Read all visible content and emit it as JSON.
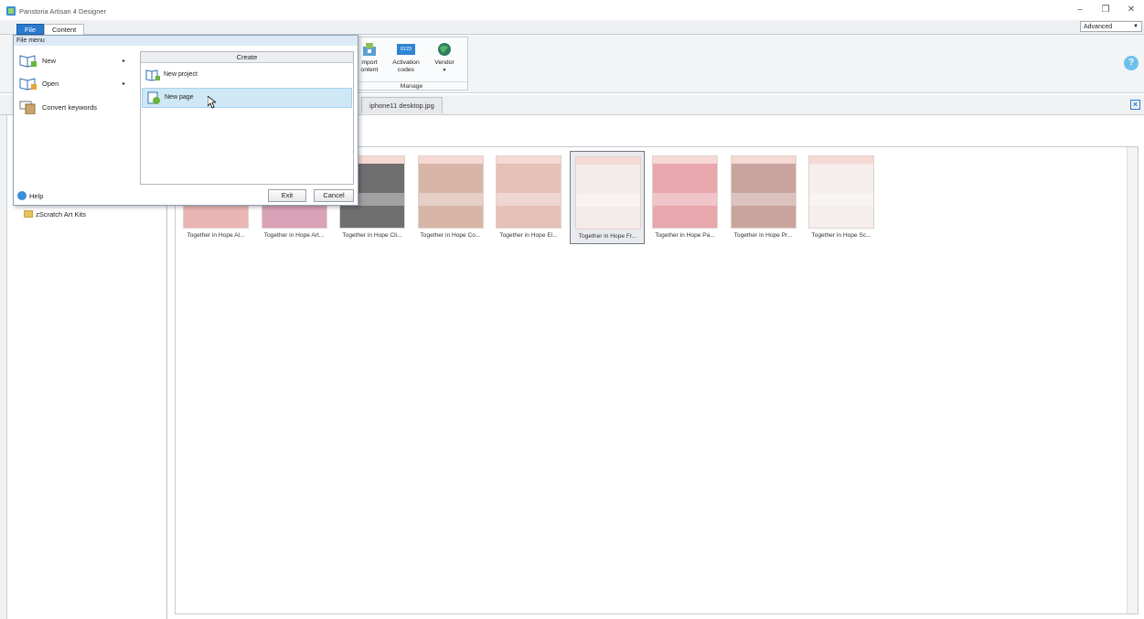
{
  "app": {
    "title": "Panstoria Artisan 4 Designer"
  },
  "window_controls": {
    "minimize": "–",
    "restore": "❐",
    "close": "✕"
  },
  "ribbon_tabs": {
    "file": "File",
    "content": "Content"
  },
  "mode_select": {
    "value": "Advanced"
  },
  "ribbon": {
    "import": "Import\ncontent",
    "import_l1": "mport",
    "import_l2": "ontent",
    "activation_l1": "Activation",
    "activation_l2": "codes",
    "activation_badge": "0123",
    "vendor": "Vendor",
    "vendor_arrow": "▼",
    "group_label": "Manage",
    "help": "?"
  },
  "doc_tab": {
    "label": "iphone11 desktop.jpg"
  },
  "left_panel": {
    "folder": "zScratch Art Kits"
  },
  "gallery": {
    "items": [
      {
        "caption": "Together in Hope Al...",
        "color": "#e9b6b4"
      },
      {
        "caption": "Together in Hope Art...",
        "color": "#d9a2b6"
      },
      {
        "caption": "Together in Hope Cli...",
        "color": "#6f6f6f"
      },
      {
        "caption": "Together in Hope Co...",
        "color": "#d7b6a8"
      },
      {
        "caption": "Together in Hope El...",
        "color": "#e6c1b7"
      },
      {
        "caption": "Together in Hope Fr...",
        "color": "#f4ecea",
        "selected": true
      },
      {
        "caption": "Together in Hope Pa...",
        "color": "#e7a7ad"
      },
      {
        "caption": "Together in Hope Pr...",
        "color": "#c9a39d"
      },
      {
        "caption": "Together in Hope Sc...",
        "color": "#f5eeec"
      }
    ]
  },
  "file_menu": {
    "header": "File menu",
    "new": "New",
    "open": "Open",
    "convert": "Convert keywords",
    "help": "Help",
    "arrow": "▸",
    "create": {
      "title": "Create",
      "new_project": "New project",
      "new_page": "New page"
    },
    "exit": "Exit",
    "cancel": "Cancel"
  }
}
